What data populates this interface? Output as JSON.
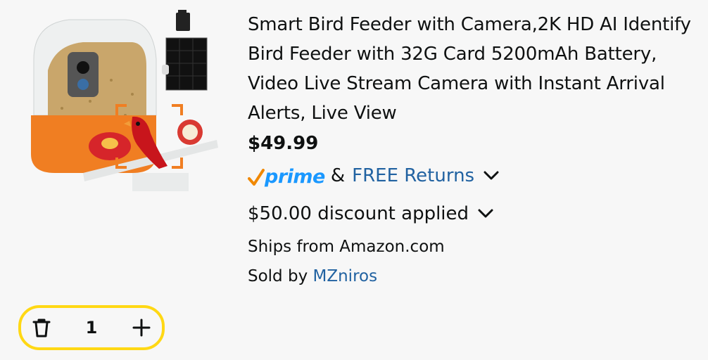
{
  "product": {
    "title": "Smart Bird Feeder with Camera,2K HD AI Identify Bird Feeder with 32G Card 5200mAh Battery, Video Live Stream Camera with Instant Arrival Alerts, Live View",
    "price": "$49.99",
    "prime_label": "prime",
    "ampersand": "&",
    "returns_label": "FREE Returns",
    "discount_text": "$50.00 discount applied",
    "ships_from": "Ships from Amazon.com",
    "sold_by_prefix": "Sold by",
    "seller": "MZniros"
  },
  "cart": {
    "quantity": "1"
  },
  "colors": {
    "link": "#2162a1",
    "prime_blue": "#1a98ff",
    "prime_check": "#f08804",
    "stepper_border": "#ffd814",
    "text": "#0f1111",
    "background": "#f7f7f7"
  },
  "icons": {
    "delete": "trash-icon",
    "increment": "plus-icon",
    "expand": "chevron-down-icon",
    "prime": "prime-check-icon"
  }
}
